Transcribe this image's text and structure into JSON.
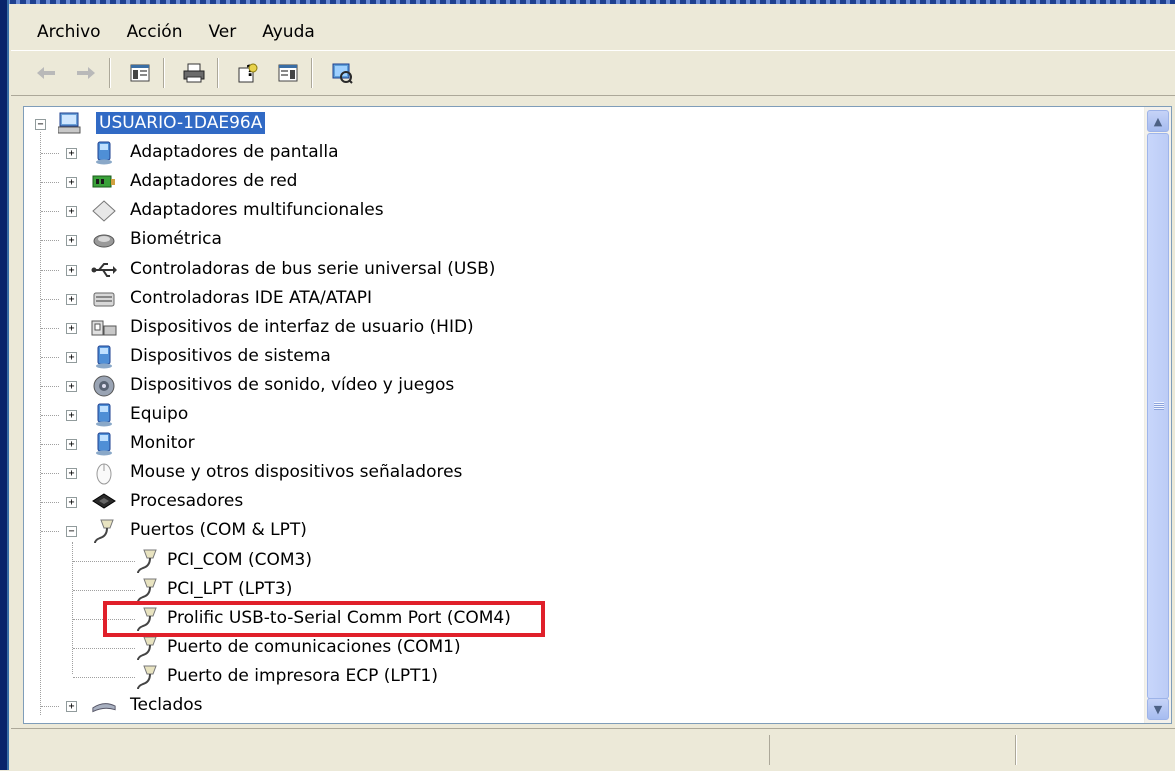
{
  "menubar": {
    "items": [
      "Archivo",
      "Acción",
      "Ver",
      "Ayuda"
    ]
  },
  "toolbar": {
    "buttons": [
      {
        "name": "back-icon"
      },
      {
        "name": "forward-icon"
      },
      {
        "name": "show-hide-console-tree-icon"
      },
      {
        "name": "print-icon"
      },
      {
        "name": "help-icon"
      },
      {
        "name": "show-hide-action-pane-icon"
      },
      {
        "name": "scan-hardware-changes-icon"
      }
    ]
  },
  "tree": {
    "root": "USUARIO-1DAE96A",
    "items": [
      {
        "label": "Adaptadores de pantalla",
        "icon": "display-adapter-icon"
      },
      {
        "label": "Adaptadores de red",
        "icon": "network-adapter-icon"
      },
      {
        "label": "Adaptadores multifuncionales",
        "icon": "multifunction-adapter-icon"
      },
      {
        "label": "Biométrica",
        "icon": "biometric-icon"
      },
      {
        "label": "Controladoras de bus serie universal (USB)",
        "icon": "usb-icon"
      },
      {
        "label": "Controladoras IDE ATA/ATAPI",
        "icon": "ide-controller-icon"
      },
      {
        "label": "Dispositivos de interfaz de usuario (HID)",
        "icon": "hid-icon"
      },
      {
        "label": "Dispositivos de sistema",
        "icon": "system-device-icon"
      },
      {
        "label": "Dispositivos de sonido, vídeo y juegos",
        "icon": "sound-icon"
      },
      {
        "label": "Equipo",
        "icon": "computer-icon"
      },
      {
        "label": "Monitor",
        "icon": "monitor-icon"
      },
      {
        "label": "Mouse y otros dispositivos señaladores",
        "icon": "mouse-icon"
      },
      {
        "label": "Procesadores",
        "icon": "processor-icon"
      },
      {
        "label": "Puertos (COM & LPT)",
        "icon": "port-icon"
      }
    ],
    "ports": [
      {
        "label": "PCI_COM (COM3)",
        "icon": "port-icon"
      },
      {
        "label": "PCI_LPT (LPT3)",
        "icon": "port-icon"
      },
      {
        "label": "Prolific USB-to-Serial Comm Port (COM4)",
        "icon": "port-icon"
      },
      {
        "label": "Puerto de comunicaciones (COM1)",
        "icon": "port-icon"
      },
      {
        "label": "Puerto de impresora ECP (LPT1)",
        "icon": "port-icon"
      }
    ],
    "last": {
      "label": "Teclados",
      "icon": "keyboard-icon"
    }
  },
  "colors": {
    "selection": "#316ac5",
    "highlight": "#e0202a",
    "chrome": "#ece9d8"
  }
}
